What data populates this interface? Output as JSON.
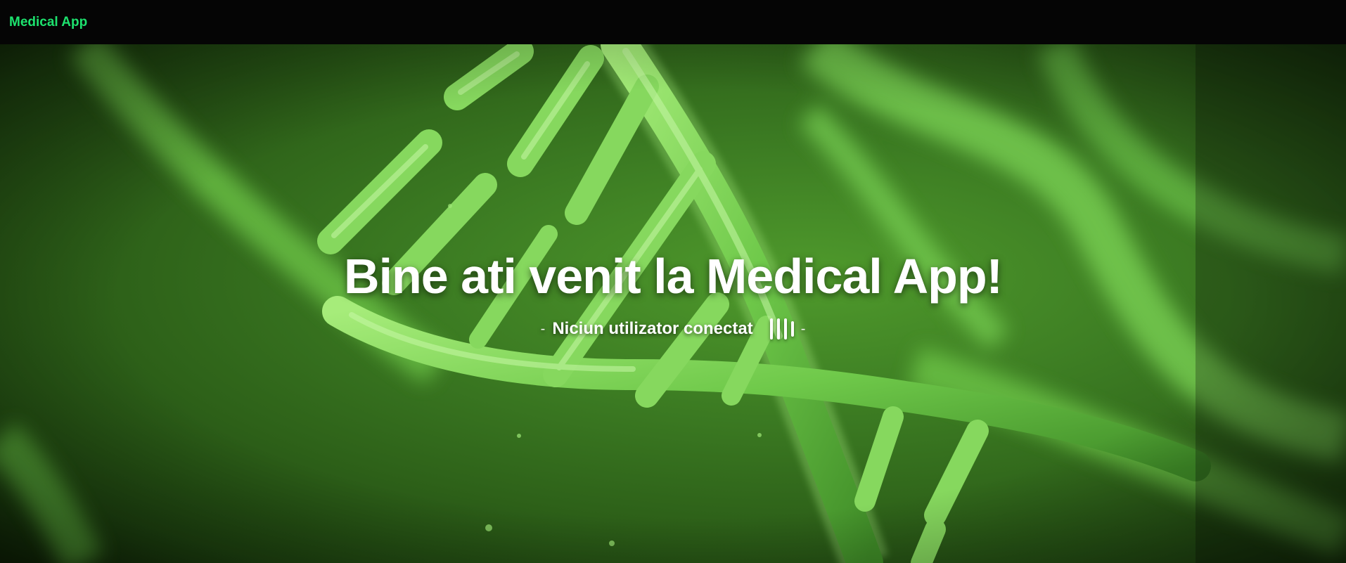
{
  "navbar": {
    "brand": "Medical App",
    "brand_color": "#1de26e"
  },
  "hero": {
    "title": "Bine ati venit la Medical App!",
    "subtitle": "Niciun utilizator conectat",
    "dash_left": "-",
    "dash_right": "-",
    "status_icon": "bars-icon",
    "background": "dna-helix-green-image"
  },
  "colors": {
    "accent": "#1de26e",
    "hero_green": "#3b7a22",
    "navbar_bg": "#050505",
    "text": "#ffffff"
  }
}
